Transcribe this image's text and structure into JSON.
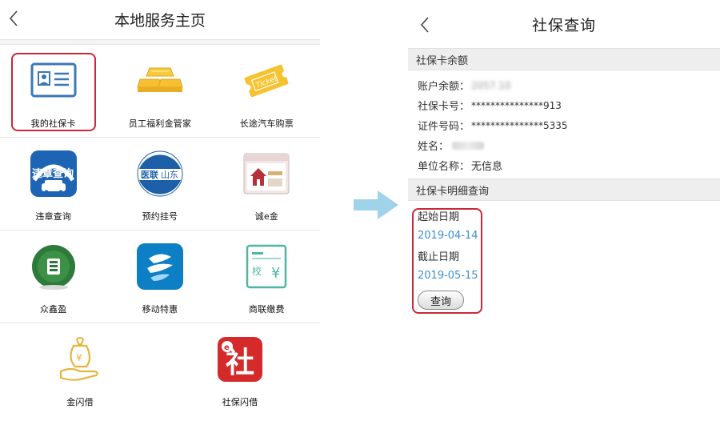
{
  "left_screen": {
    "title": "本地服务主页",
    "back_icon": "chevron-left-icon",
    "services": [
      {
        "label": "我的社保卡",
        "icon": "id-card-icon"
      },
      {
        "label": "员工福利金管家",
        "icon": "gold-bars-icon"
      },
      {
        "label": "长途汽车购票",
        "icon": "ticket-icon"
      },
      {
        "label": "违章查询",
        "icon": "traffic-violation-icon"
      },
      {
        "label": "预约挂号",
        "icon": "medical-appointment-icon"
      },
      {
        "label": "诚e金",
        "icon": "house-card-icon"
      },
      {
        "label": "众鑫盈",
        "icon": "coin-icon"
      },
      {
        "label": "移动特惠",
        "icon": "china-mobile-icon"
      },
      {
        "label": "商联缴费",
        "icon": "payment-bill-icon"
      },
      {
        "label": "金闪借",
        "icon": "money-bag-hand-icon"
      },
      {
        "label": "社保闪借",
        "icon": "she-badge-icon"
      }
    ],
    "icon_texts": {
      "weizhang": "违章查询",
      "yilian": "医联",
      "shandong": "山东",
      "ticket": "Ticket",
      "she": "社",
      "jiao": "校",
      "yen": "¥"
    }
  },
  "right_screen": {
    "title": "社保查询",
    "back_icon": "chevron-left-icon",
    "balance_section": "社保卡余额",
    "fields": [
      {
        "key": "账户余额：",
        "value": "2057.10"
      },
      {
        "key": "社保卡号：",
        "value": "***************913"
      },
      {
        "key": "证件号码：",
        "value": "***************5335"
      },
      {
        "key": "姓名：",
        "value": ""
      },
      {
        "key": "单位名称：",
        "value": "无信息"
      }
    ],
    "detail_section": "社保卡明细查询",
    "start_label": "起始日期",
    "start_date": "2019-04-14",
    "end_label": "截止日期",
    "end_date": "2019-05-15",
    "query_button": "查询"
  },
  "colors": {
    "highlight": "#c8283a",
    "arrow": "#9fd3ea",
    "date_blue": "#3f8fd0"
  }
}
